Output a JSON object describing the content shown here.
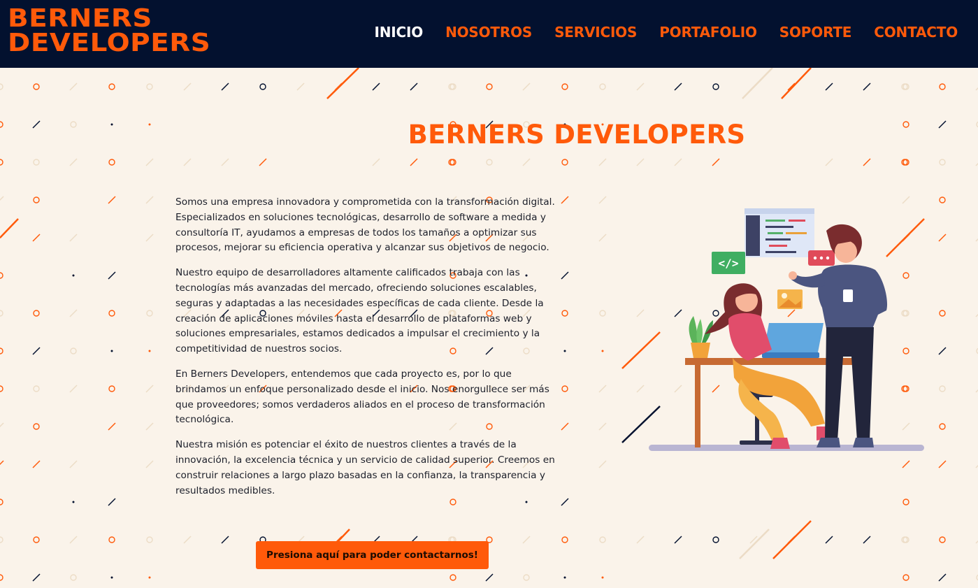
{
  "header": {
    "logo_line1": "BERNERS",
    "logo_line2": "DEVELOPERS",
    "nav": [
      "INICIO",
      "NOSOTROS",
      "SERVICIOS",
      "PORTAFOLIO",
      "SOPORTE",
      "CONTACTO"
    ]
  },
  "main": {
    "title": "BERNERS DEVELOPERS",
    "paragraphs": [
      "Somos una empresa innovadora y comprometida con la transformación digital. Especializados en soluciones tecnológicas, desarrollo de software a medida y consultoría IT, ayudamos a empresas de todos los tamaños a optimizar sus procesos, mejorar su eficiencia operativa y alcanzar sus objetivos de negocio.",
      "Nuestro equipo de desarrolladores altamente calificados trabaja con las tecnologías más avanzadas del mercado, ofreciendo soluciones escalables, seguras y adaptadas a las necesidades específicas de cada cliente. Desde la creación de aplicaciones móviles hasta el desarrollo de plataformas web y soluciones empresariales, estamos dedicados a impulsar el crecimiento y la competitividad de nuestros socios.",
      "En Berners Developers, entendemos que cada proyecto es, por lo que brindamos un enfoque personalizado desde el inicio. Nos enorgullece ser más que proveedores; somos verdaderos aliados en el proceso de transformación tecnológica.",
      "Nuestra misión es potenciar el éxito de nuestros clientes a través de la innovación, la excelencia técnica y un servicio de calidad superior. Creemos en construir relaciones a largo plazo basadas en la confianza, la transparencia y resultados medibles."
    ],
    "cta_label": "Presiona aquí para poder contactarnos!",
    "illustration_code_icon": "</>"
  },
  "colors": {
    "accent": "#ff5a0a",
    "header_bg": "#03112f",
    "page_bg": "#faf3ea"
  }
}
